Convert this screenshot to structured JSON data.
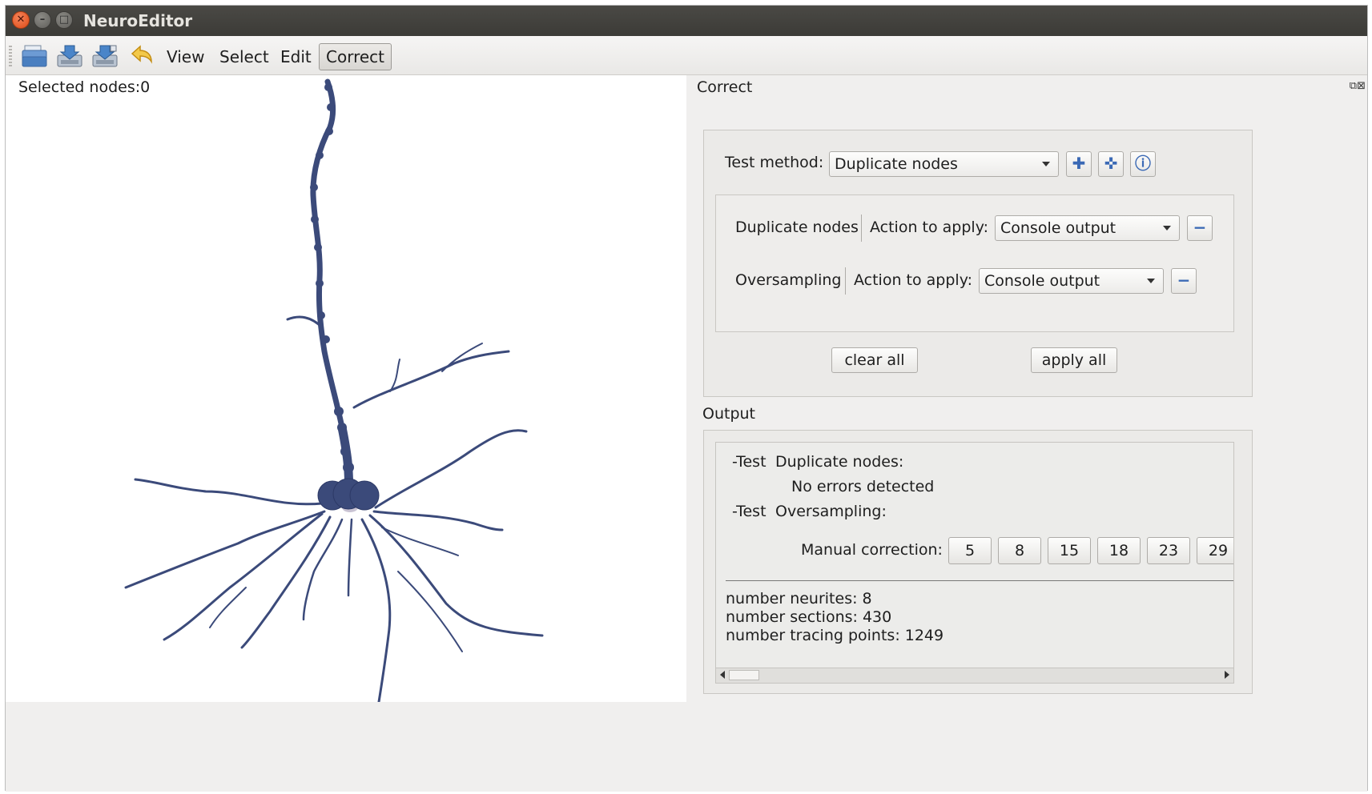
{
  "window": {
    "title": "NeuroEditor"
  },
  "toolbar": {
    "icons": [
      "open-file-icon",
      "save-icon",
      "save-as-icon",
      "undo-icon"
    ],
    "menus": {
      "view": "View",
      "select": "Select",
      "edit": "Edit",
      "correct": "Correct"
    }
  },
  "viewer": {
    "selected_nodes": "Selected nodes:0"
  },
  "correct_panel": {
    "title": "Correct",
    "test_method_label": "Test method:",
    "test_method_value": "Duplicate nodes",
    "tool_buttons": [
      "add-icon",
      "add-all-icon",
      "help-icon"
    ],
    "rows": [
      {
        "test": "Duplicate nodes",
        "action_label": "Action to apply:",
        "action_value": "Console output"
      },
      {
        "test": "Oversampling",
        "action_label": "Action to apply:",
        "action_value": "Console output"
      }
    ],
    "clear_all": "clear all",
    "apply_all": "apply all"
  },
  "output": {
    "title": "Output",
    "line1_prefix": "-Test",
    "line1_test": "Duplicate nodes:",
    "line2": "No errors detected",
    "line3_prefix": "-Test",
    "line3_test": "Oversampling:",
    "manual_label": "Manual correction:",
    "manual_values": [
      "5",
      "8",
      "15",
      "18",
      "23",
      "29"
    ],
    "stats": [
      "number neurites: 8",
      "number sections: 430",
      "number tracing points: 1249"
    ]
  },
  "colors": {
    "neuron": "#3b4a7a",
    "neuron_light": "#c9c3d3",
    "titlebar": "#3c3b37",
    "close_button": "#df4a16"
  }
}
